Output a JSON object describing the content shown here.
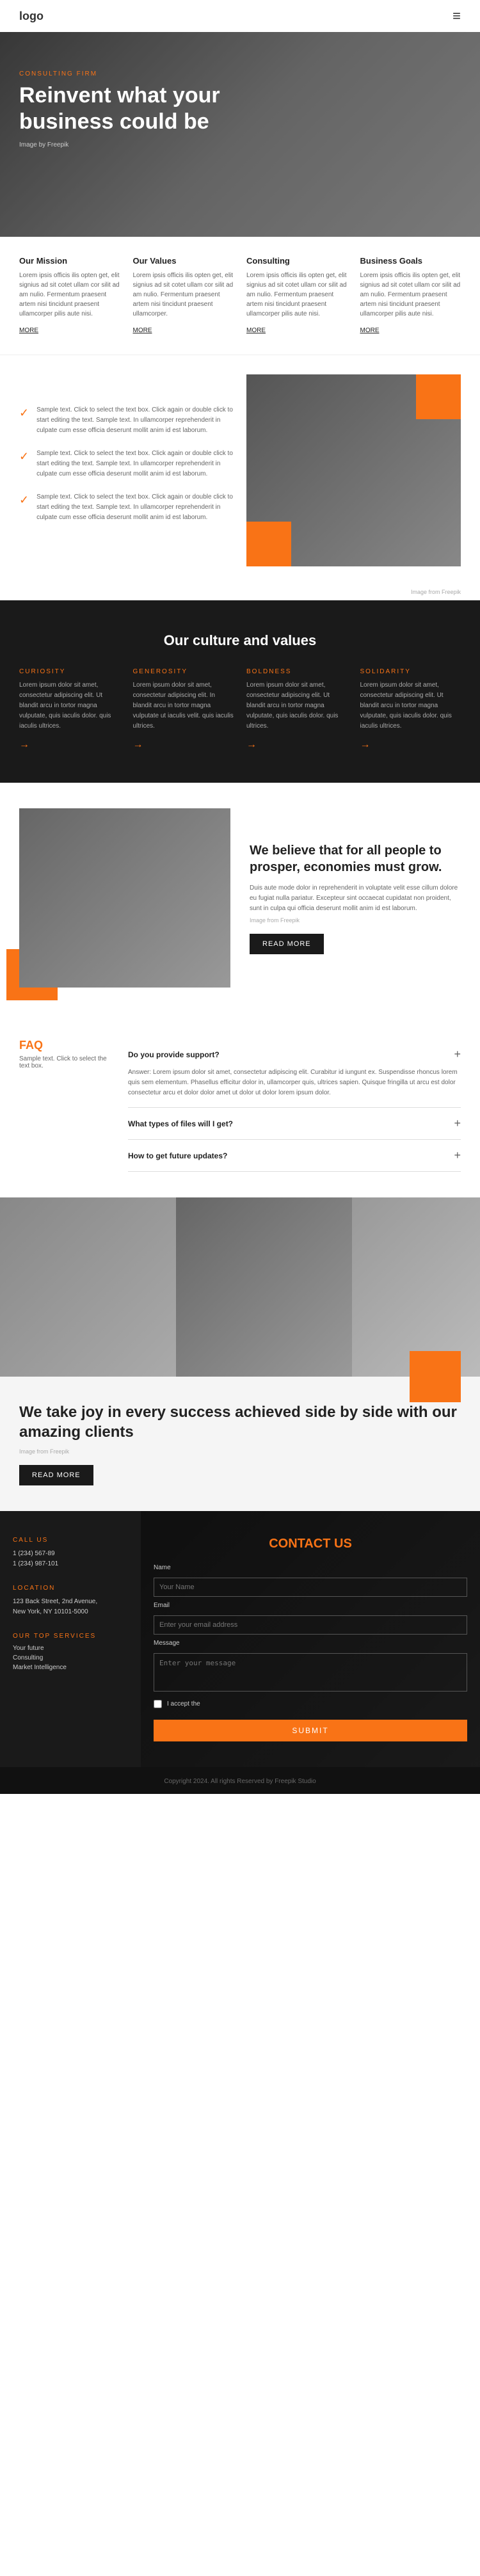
{
  "header": {
    "logo": "logo",
    "menu_icon": "≡"
  },
  "hero": {
    "tag": "CONSULTING FIRM",
    "title": "Reinvent what your business could be",
    "credit": "Image by Freepik"
  },
  "info": {
    "cols": [
      {
        "title": "Our Mission",
        "text": "Lorem ipsis officis ilis opten get, elit signius ad sit cotet ullam cor silit ad am nulio. Fermentum praesent artem nisi tincidunt praesent ullamcorper pilis aute nisi.",
        "more": "MORE"
      },
      {
        "title": "Our Values",
        "text": "Lorem ipsis officis ilis opten get, elit signius ad sit cotet ullam cor silit ad am nulio. Fermentum praesent artem nisi tincidunt praesent ullamcorper.",
        "more": "MORE"
      },
      {
        "title": "Consulting",
        "text": "Lorem ipsis officis ilis opten get, elit signius ad sit cotet ullam cor silit ad am nulio. Fermentum praesent artem nisi tincidunt praesent ullamcorper pilis aute nisi.",
        "more": "MORE"
      },
      {
        "title": "Business Goals",
        "text": "Lorem ipsis officis ilis opten get, elit signius ad sit cotet ullam cor silit ad am nulio. Fermentum praesent artem nisi tincidunt praesent ullamcorper pilis aute nisi.",
        "more": "MORE"
      }
    ]
  },
  "features": {
    "items": [
      "Sample text. Click to select the text box. Click again or double click to start editing the text. Sample text. In ullamcorper reprehenderit in culpate cum esse officia deserunt mollit anim id est laborum.",
      "Sample text. Click to select the text box. Click again or double click to start editing the text. Sample text. In ullamcorper reprehenderit in culpate cum esse officia deserunt mollit anim id est laborum.",
      "Sample text. Click to select the text box. Click again or double click to start editing the text. Sample text. In ullamcorper reprehenderit in culpate cum esse officia deserunt mollit anim id est laborum."
    ],
    "credit": "Image from Freepik"
  },
  "culture": {
    "title": "Our culture and values",
    "cols": [
      {
        "tag": "CURIOSITY",
        "text": "Lorem ipsum dolor sit amet, consectetur adipiscing elit. Ut blandit arcu in tortor magna vulputate, quis iaculis dolor. quis iaculis ultrices."
      },
      {
        "tag": "GENEROSITY",
        "text": "Lorem ipsum dolor sit amet, consectetur adipiscing elit. In blandit arcu in tortor magna vulputate ut iaculis velit. quis iaculis ultrices."
      },
      {
        "tag": "BOLDNESS",
        "text": "Lorem ipsum dolor sit amet, consectetur adipiscing elit. Ut blandit arcu in tortor magna vulputate, quis iaculis dolor. quis ultrices."
      },
      {
        "tag": "SOLIDARITY",
        "text": "Lorem ipsum dolor sit amet, consectetur adipiscing elit. Ut blandit arcu in tortor magna vulputate, quis iaculis dolor. quis iaculis ultrices."
      }
    ]
  },
  "believe": {
    "title": "We believe that for all people to prosper, economies must grow.",
    "text": "Duis aute mode dolor in reprehenderit in voluptate velit esse cillum dolore eu fugiat nulla pariatur. Excepteur sint occaecat cupidatat non proident, sunt in culpa qui officia deserunt mollit anim id est laborum.",
    "credit": "Image from Freepik",
    "btn": "READ MORE"
  },
  "faq": {
    "heading": "FAQ",
    "sub": "Sample text. Click to select the text box.",
    "items": [
      {
        "question": "Do you provide support?",
        "answer": "Answer: Lorem ipsum dolor sit amet, consectetur adipiscing elit. Curabitur id iungunt ex. Suspendisse rhoncus lorem quis sem elementum. Phasellus efficitur dolor in, ullamcorper quis, ultrices sapien. Quisque fringilla ut arcu est dolor consectetur arcu et dolor dolor amet ut dolor ut dolor lorem ipsum dolor.",
        "open": true
      },
      {
        "question": "What types of files will I get?",
        "answer": "",
        "open": false
      },
      {
        "question": "How to get future updates?",
        "answer": "",
        "open": false
      }
    ]
  },
  "clients": {
    "title": "We take joy in every success achieved side by side with our amazing clients",
    "credit": "Image from Freepik",
    "btn": "READ MORE"
  },
  "contact": {
    "title": "CONTACT US",
    "call_label": "CALL US",
    "call_value": "1 (234) 567-89\n1 (234) 987-101",
    "location_label": "LOCATION",
    "location_value": "123 Back Street, 2nd Avenue,\nNew York, NY 10101-5000",
    "services_label": "OUR TOP SERVICES",
    "services": [
      "Your future",
      "Consulting",
      "Market Intelligence"
    ],
    "form": {
      "name_label": "Name",
      "name_placeholder": "Your Name",
      "email_label": "Email",
      "email_placeholder": "Enter your email address",
      "message_label": "Message",
      "message_placeholder": "Enter your message",
      "checkbox_label": "I accept the",
      "submit": "SUBMIT"
    }
  },
  "footer": {
    "text": "Copyright 2024. All rights Reserved by Freepik Studio"
  }
}
